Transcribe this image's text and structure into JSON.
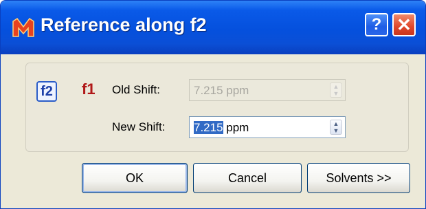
{
  "window": {
    "title": "Reference along f2"
  },
  "titlebar": {
    "help_label": "?",
    "close_label": "✕"
  },
  "panel": {
    "f2_icon_label": "f2",
    "f1_icon_label": "f1",
    "old_shift": {
      "label": "Old Shift:",
      "value": "7.215 ppm"
    },
    "new_shift": {
      "label": "New Shift:",
      "value_selected": "7.215",
      "value_unit": " ppm"
    }
  },
  "buttons": {
    "ok": "OK",
    "cancel": "Cancel",
    "solvents": "Solvents >>"
  },
  "icons": [
    "app-logo-icon",
    "help-icon",
    "close-icon",
    "f2-icon",
    "f1-icon",
    "spin-arrows-icon"
  ]
}
